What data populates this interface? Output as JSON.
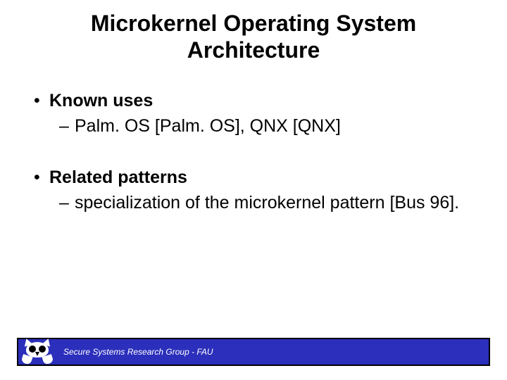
{
  "title_line1": "Microkernel Operating System",
  "title_line2": "Architecture",
  "bullets": {
    "known_uses": {
      "label": "Known uses",
      "item1": "Palm. OS [Palm. OS], QNX [QNX]"
    },
    "related_patterns": {
      "label": "Related patterns",
      "item1": "specialization of the microkernel pattern [Bus 96]."
    }
  },
  "footer": {
    "text": "Secure Systems Research Group - FAU"
  }
}
